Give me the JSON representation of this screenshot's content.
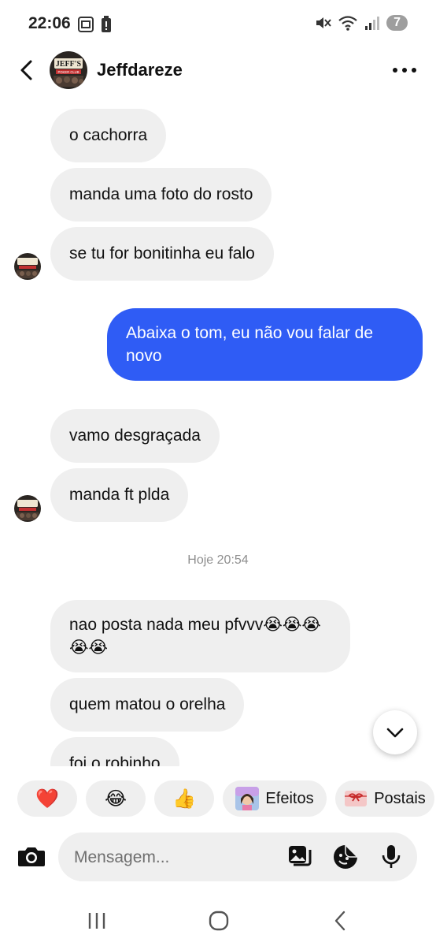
{
  "status_bar": {
    "time": "22:06",
    "notification_count": "7",
    "icons": [
      "screenshot-icon",
      "battery-alert-icon",
      "mute-icon",
      "wifi-icon",
      "signal-icon"
    ]
  },
  "header": {
    "contact_name": "Jeffdareze",
    "avatar_text_top": "JEFF'S",
    "avatar_text_bottom": "POKER CLUB",
    "back_icon": "chevron-left-icon",
    "menu_icon": "more-horizontal-icon"
  },
  "messages": [
    {
      "direction": "in",
      "text": "o cachorra"
    },
    {
      "direction": "in",
      "text": "manda uma foto do rosto"
    },
    {
      "direction": "in",
      "text": "se tu for bonitinha eu falo"
    },
    {
      "direction": "out",
      "text": "Abaixa o tom, eu não vou falar de novo"
    },
    {
      "direction": "in",
      "text": "vamo desgraçada"
    },
    {
      "direction": "in",
      "text": "manda ft plda"
    },
    {
      "direction": "in",
      "text": "nao posta nada meu pfvvv😭😭😭😭😭"
    },
    {
      "direction": "in",
      "text": "quem matou o orelha"
    },
    {
      "direction": "in",
      "text": "foi o robinho"
    }
  ],
  "timestamp": "Hoje 20:54",
  "reactions": [
    {
      "emoji": "❤️",
      "label": ""
    },
    {
      "emoji": "😂",
      "label": ""
    },
    {
      "emoji": "👍",
      "label": ""
    },
    {
      "emoji": "",
      "label": "Efeitos"
    },
    {
      "emoji": "",
      "label": "Postais"
    }
  ],
  "composer": {
    "placeholder": "Mensagem...",
    "icons": [
      "camera-icon",
      "gallery-icon",
      "sticker-icon",
      "microphone-icon"
    ]
  },
  "colors": {
    "outgoing_bubble": "#2f5cf5",
    "incoming_bubble": "#efefef",
    "background": "#ffffff"
  }
}
